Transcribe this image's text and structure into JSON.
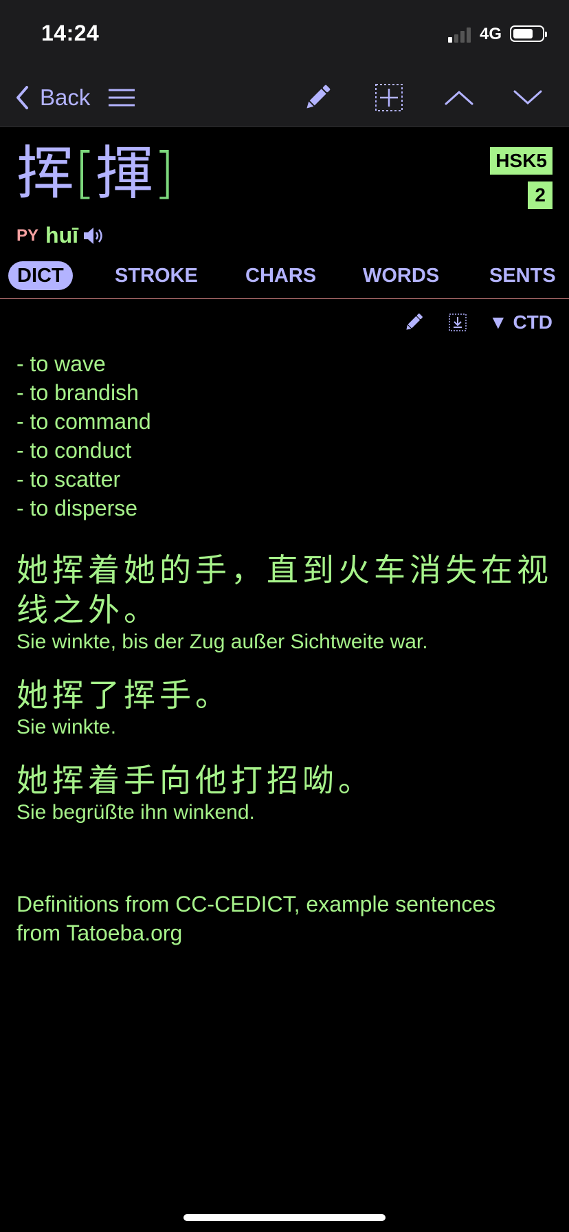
{
  "status": {
    "time": "14:24",
    "network": "4G"
  },
  "nav": {
    "back_label": "Back"
  },
  "entry": {
    "simplified": "挥",
    "traditional": "揮",
    "bracket_open": "[",
    "bracket_close": "]",
    "hsk": "HSK5",
    "frequency": "2",
    "pinyin_label": "PY",
    "pinyin": "huī"
  },
  "tabs": [
    {
      "label": "DICT",
      "active": true
    },
    {
      "label": "STROKE",
      "active": false
    },
    {
      "label": "CHARS",
      "active": false
    },
    {
      "label": "WORDS",
      "active": false
    },
    {
      "label": "SENTS",
      "active": false
    }
  ],
  "dict_tools": {
    "ctd_label": "▼ CTD"
  },
  "definitions": [
    "- to wave",
    "- to brandish",
    "- to command",
    "- to conduct",
    "- to scatter",
    "- to disperse"
  ],
  "sentences": [
    {
      "zh": "她挥着她的手，直到火车消失在视线之外。",
      "de": "Sie winkte, bis der Zug außer Sichtweite war."
    },
    {
      "zh": "她挥了挥手。",
      "de": "Sie winkte."
    },
    {
      "zh": "她挥着手向他打招呦。",
      "de": "Sie begrüßte ihn winkend."
    }
  ],
  "footer": "Definitions from CC-CEDICT, example sentences from Tatoeba.org",
  "colors": {
    "accent": "#b3b3ff",
    "green": "#a6f28a",
    "pinyin_label": "#f4a0a0",
    "background": "#000000"
  }
}
